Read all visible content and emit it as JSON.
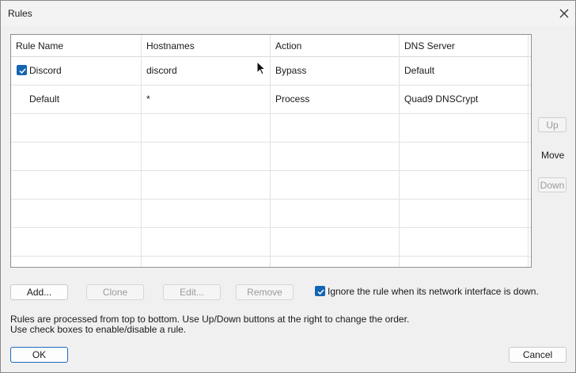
{
  "window": {
    "title": "Rules"
  },
  "table": {
    "columns": [
      "Rule Name",
      "Hostnames",
      "Action",
      "DNS Server"
    ],
    "rows": [
      {
        "enabled": true,
        "name": "Discord",
        "hostnames": "discord",
        "action": "Bypass",
        "dns": "Default"
      },
      {
        "enabled": false,
        "name": "Default",
        "hostnames": "*",
        "action": "Process",
        "dns": "Quad9 DNSCrypt"
      }
    ]
  },
  "side": {
    "up": "Up",
    "move": "Move",
    "down": "Down"
  },
  "buttons": {
    "add": "Add...",
    "clone": "Clone",
    "edit": "Edit...",
    "remove": "Remove",
    "ok": "OK",
    "cancel": "Cancel"
  },
  "ignore": {
    "checked": true,
    "label": "Ignore the rule when its network interface is down."
  },
  "help": {
    "line1": "Rules are processed from top to bottom. Use Up/Down buttons at the right to change the order.",
    "line2": "Use check boxes to enable/disable a rule."
  },
  "colors": {
    "accent": "#1464b4",
    "window_bg": "#f0f0f0",
    "grid_bg": "#ffffff"
  },
  "icons": {
    "close": "close-icon",
    "checkbox": "checkmark-icon",
    "cursor": "mouse-pointer-icon"
  }
}
